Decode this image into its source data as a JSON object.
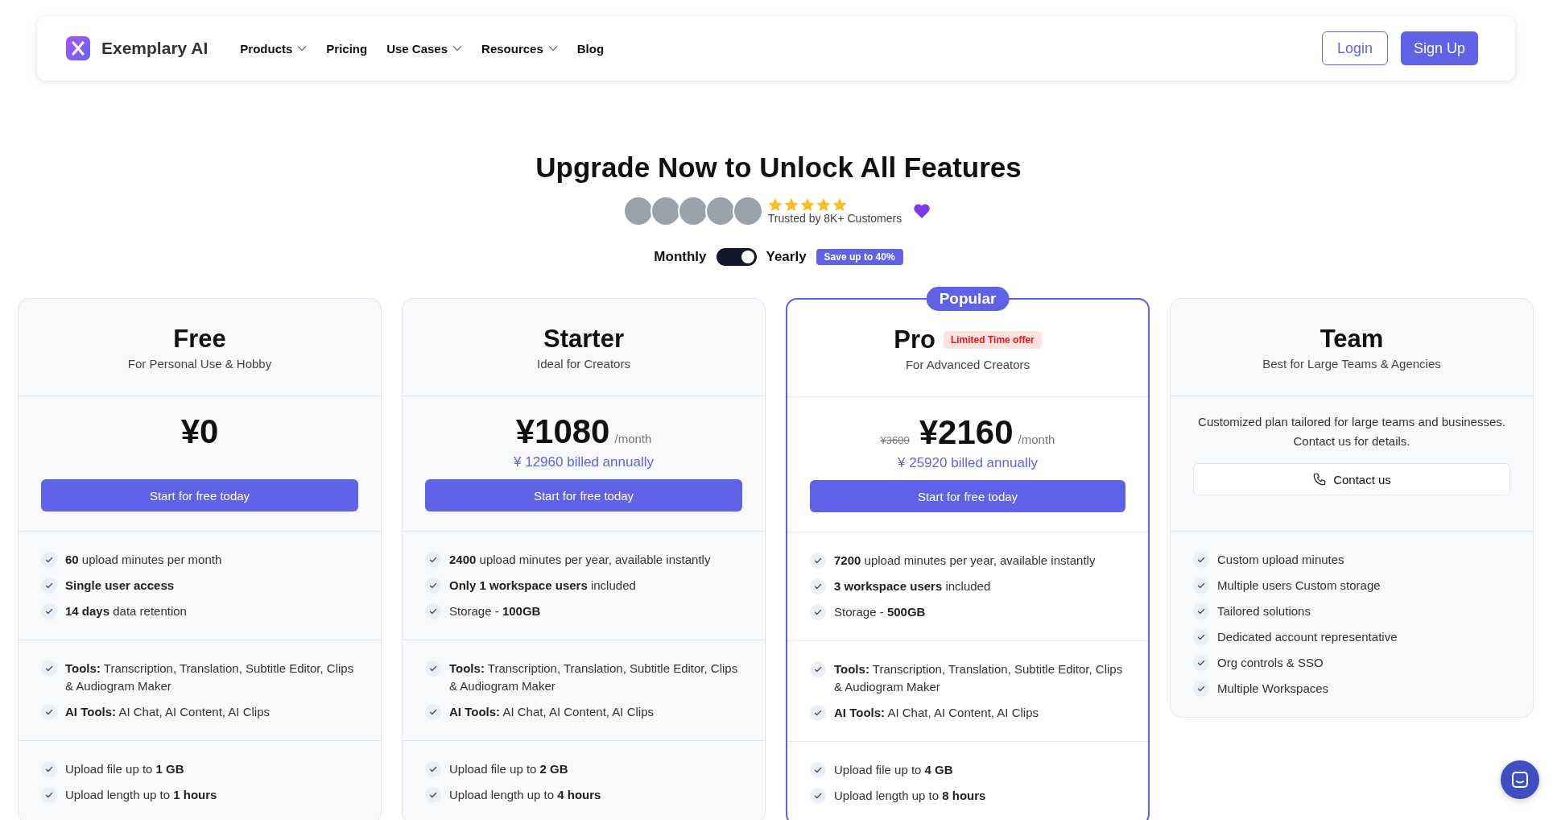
{
  "nav": {
    "brand": "Exemplary AI",
    "links": [
      {
        "label": "Products",
        "dropdown": true
      },
      {
        "label": "Pricing",
        "dropdown": false
      },
      {
        "label": "Use Cases",
        "dropdown": true
      },
      {
        "label": "Resources",
        "dropdown": true
      },
      {
        "label": "Blog",
        "dropdown": false
      }
    ],
    "login": "Login",
    "signup": "Sign Up"
  },
  "hero": {
    "title": "Upgrade Now to Unlock All Features",
    "stars": 5,
    "trust": "Trusted by 8K+ Customers"
  },
  "billing": {
    "monthly_label": "Monthly",
    "yearly_label": "Yearly",
    "yearly": true,
    "save_badge": "Save up to 40%"
  },
  "plans": [
    {
      "kind": "priced",
      "name": "Free",
      "subtitle": "For Personal Use & Hobby",
      "highlighted": false,
      "price": "¥0",
      "cta": "Start for free today",
      "groups": [
        [
          "**60** upload minutes per month",
          "**Single user access**",
          "**14 days** data retention"
        ],
        [
          "**Tools:** Transcription, Translation, Subtitle Editor, Clips & Audiogram Maker",
          "**AI Tools:** AI Chat, AI Content, AI Clips"
        ],
        [
          "Upload file up to **1 GB**",
          "Upload length up to **1 hours**"
        ]
      ]
    },
    {
      "kind": "priced",
      "name": "Starter",
      "subtitle": "Ideal for Creators",
      "highlighted": false,
      "price": "¥1080",
      "period": "/month",
      "billed": "¥ 12960 billed annually",
      "cta": "Start for free today",
      "groups": [
        [
          "**2400** upload minutes per year, available instantly",
          "**Only 1 workspace users** included",
          "Storage - **100GB**"
        ],
        [
          "**Tools:** Transcription, Translation, Subtitle Editor, Clips & Audiogram Maker",
          "**AI Tools:** AI Chat, AI Content, AI Clips"
        ],
        [
          "Upload file up to **2 GB**",
          "Upload length up to **4 hours**"
        ]
      ]
    },
    {
      "kind": "priced",
      "name": "Pro",
      "badge": "Popular",
      "offer": "Limited Time offer",
      "subtitle": "For Advanced Creators",
      "highlighted": true,
      "old_price": "¥3600",
      "price": "¥2160",
      "period": "/month",
      "billed": "¥ 25920 billed annually",
      "cta": "Start for free today",
      "groups": [
        [
          "**7200** upload minutes per year, available instantly",
          "**3 workspace users** included",
          "Storage - **500GB**"
        ],
        [
          "**Tools:** Transcription, Translation, Subtitle Editor, Clips & Audiogram Maker",
          "**AI Tools:** AI Chat, AI Content, AI Clips"
        ],
        [
          "Upload file up to **4 GB**",
          "Upload length up to **8 hours**"
        ]
      ]
    },
    {
      "kind": "contact",
      "name": "Team",
      "subtitle": "Best for Large Teams & Agencies",
      "highlighted": false,
      "description": "Customized plan tailored for large teams and businesses. Contact us for details.",
      "cta": "Contact us",
      "groups": [
        [
          "Custom upload minutes",
          "Multiple users Custom storage",
          "Tailored solutions",
          "Dedicated account representative",
          "Org controls & SSO",
          "Multiple Workspaces"
        ]
      ]
    }
  ]
}
